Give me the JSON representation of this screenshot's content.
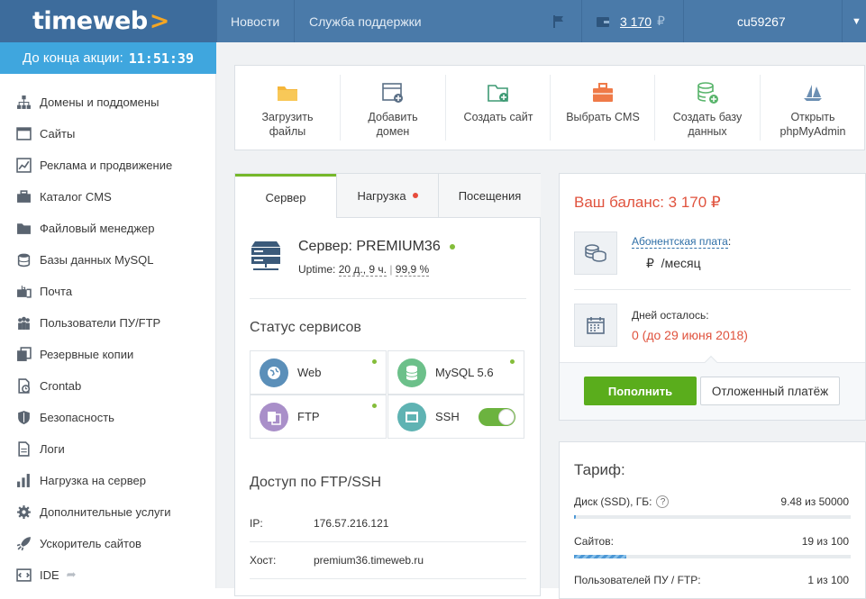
{
  "header": {
    "logo": "timeweb",
    "logo_arrow": ">",
    "nav": [
      "Новости",
      "Служба поддержки"
    ],
    "balance": "3 170",
    "currency": "₽",
    "account": "cu59267"
  },
  "promo": {
    "label": "До конца акции:",
    "timer": "11:51:39"
  },
  "sidebar": {
    "items": [
      {
        "label": "Домены и поддомены",
        "icon": "sitemap-icon"
      },
      {
        "label": "Сайты",
        "icon": "browser-icon"
      },
      {
        "label": "Реклама и продвижение",
        "icon": "chart-icon"
      },
      {
        "label": "Каталог CMS",
        "icon": "briefcase-icon"
      },
      {
        "label": "Файловый менеджер",
        "icon": "folder-icon"
      },
      {
        "label": "Базы данных MySQL",
        "icon": "database-icon"
      },
      {
        "label": "Почта",
        "icon": "mailbox-icon"
      },
      {
        "label": "Пользователи ПУ/FTP",
        "icon": "users-icon"
      },
      {
        "label": "Резервные копии",
        "icon": "backup-icon"
      },
      {
        "label": "Crontab",
        "icon": "clock-icon"
      },
      {
        "label": "Безопасность",
        "icon": "shield-icon"
      },
      {
        "label": "Логи",
        "icon": "log-icon"
      },
      {
        "label": "Нагрузка на сервер",
        "icon": "load-icon"
      },
      {
        "label": "Дополнительные услуги",
        "icon": "gear-icon"
      },
      {
        "label": "Ускоритель сайтов",
        "icon": "rocket-icon"
      },
      {
        "label": "IDE",
        "icon": "code-icon"
      }
    ]
  },
  "actions": [
    {
      "label": "Загрузить файлы",
      "line1": "Загрузить",
      "line2": "файлы",
      "icon": "folder-upload-icon"
    },
    {
      "label": "Добавить домен",
      "line1": "Добавить",
      "line2": "домен",
      "icon": "add-domain-icon"
    },
    {
      "label": "Создать сайт",
      "line1": "Создать сайт",
      "line2": "",
      "icon": "create-site-icon"
    },
    {
      "label": "Выбрать CMS",
      "line1": "Выбрать CMS",
      "line2": "",
      "icon": "cms-icon"
    },
    {
      "label": "Создать базу данных",
      "line1": "Создать базу",
      "line2": "данных",
      "icon": "add-database-icon"
    },
    {
      "label": "Открыть phpMyAdmin",
      "line1": "Открыть",
      "line2": "phpMyAdmin",
      "icon": "phpmyadmin-icon"
    }
  ],
  "server": {
    "tabs": [
      "Сервер",
      "Нагрузка",
      "Посещения"
    ],
    "title": "Сервер: PREMIUM36",
    "uptime_label": "Uptime:",
    "uptime_value": "20 д., 9 ч.",
    "uptime_sep": "|",
    "uptime_percent": "99,9 %",
    "services_title": "Статус сервисов",
    "services": [
      {
        "name": "Web",
        "color": "#5b8fb9"
      },
      {
        "name": "MySQL 5.6",
        "color": "#6cc08a"
      },
      {
        "name": "FTP",
        "color": "#a98fc9"
      },
      {
        "name": "SSH",
        "color": "#5fb3b3"
      }
    ],
    "ssh_enabled": true,
    "access_title": "Доступ по FTP/SSH",
    "ip_label": "IP:",
    "ip_value": "176.57.216.121",
    "host_label": "Хост:",
    "host_value": "premium36.timeweb.ru"
  },
  "balance_panel": {
    "title": "Ваш баланс: 3 170 ₽",
    "fee_label": "Абонентская плата",
    "fee_colon": ":",
    "fee_value": "₽  /месяц",
    "days_label": "Дней осталось:",
    "days_value": "0 (до 29 июня 2018)",
    "topup_button": "Пополнить",
    "deferred_button": "Отложенный платёж"
  },
  "tariff": {
    "title": "Тариф:",
    "disk_label": "Диск (SSD), ГБ:",
    "disk_value": "9.48 из 50000",
    "disk_fraction": 0.0002,
    "sites_label": "Сайтов:",
    "sites_value": "19 из 100",
    "sites_fraction": 0.19,
    "users_label": "Пользователей ПУ / FTP:",
    "users_value": "1 из 100"
  },
  "colors": {
    "header_bg": "#4a7aa9",
    "promo_bg": "#3fa6de",
    "accent_green": "#5aad1c",
    "balance_red": "#e0533e",
    "active_tab": "#76b82a"
  }
}
